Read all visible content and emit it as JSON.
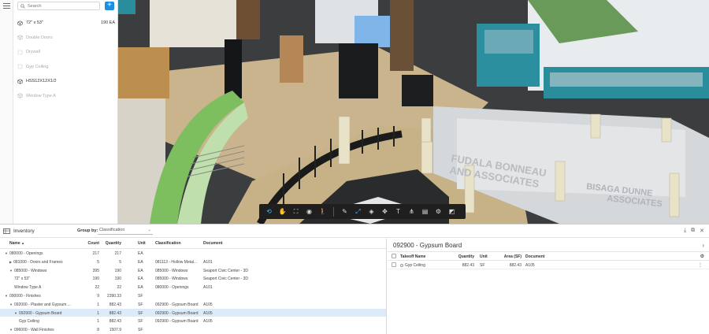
{
  "search": {
    "placeholder": "Search"
  },
  "takeoffs": [
    {
      "name": "72\" x 53\"",
      "quantity": "190 EA",
      "icon": "cube-icon",
      "active": true
    },
    {
      "name": "Double Doors",
      "quantity": "",
      "icon": "cube-icon",
      "active": false
    },
    {
      "name": "Drywall",
      "quantity": "",
      "icon": "area-icon",
      "active": false
    },
    {
      "name": "Gyp Ceiling",
      "quantity": "",
      "icon": "area-icon",
      "active": false
    },
    {
      "name": "HSS12X12X1/2",
      "quantity": "",
      "icon": "cube-icon",
      "active": true
    },
    {
      "name": "Window Type A",
      "quantity": "",
      "icon": "cube-icon",
      "active": false
    }
  ],
  "viewport": {
    "sign_1_line1": "FUDALA BONNEAU",
    "sign_1_line2": "AND ASSOCIATES",
    "sign_2_line1": "BISAGA DUNNE",
    "sign_2_line2": "ASSOCIATES"
  },
  "toolbar": {
    "tools": [
      "orbit-icon",
      "hand-icon",
      "fit-icon",
      "camera-icon",
      "walk-icon",
      "pencil-icon",
      "measure-icon",
      "layers-icon",
      "cube-sections-icon",
      "text-icon",
      "tree-icon",
      "properties-icon",
      "settings-icon",
      "fullscreen-icon"
    ]
  },
  "inventory": {
    "title": "Inventory",
    "group_by_label": "Group by:",
    "group_by_value": "Classification",
    "columns": {
      "name": "Name",
      "count": "Count",
      "quantity": "Quantity",
      "unit": "Unit",
      "classification": "Classification",
      "document": "Document"
    },
    "rows": [
      {
        "indent": 0,
        "tri": "▼",
        "name": "080000 - Openings",
        "count": "217",
        "qty": "217",
        "unit": "EA",
        "cls": "",
        "doc": ""
      },
      {
        "indent": 1,
        "tri": "▶",
        "name": "081000 - Doors and Frames",
        "count": "5",
        "qty": "5",
        "unit": "EA",
        "cls": "081113 - Hollow Metal...",
        "doc": "A101"
      },
      {
        "indent": 1,
        "tri": "▼",
        "name": "085000 - Windows",
        "count": "395",
        "qty": "190",
        "unit": "EA",
        "cls": "085000 - Windows",
        "doc": "Seaport Civic Center - 3D"
      },
      {
        "indent": 2,
        "tri": "",
        "name": "72\" x 53\"",
        "count": "190",
        "qty": "190",
        "unit": "EA",
        "cls": "085000 - Windows",
        "doc": "Seaport Civic Center - 3D"
      },
      {
        "indent": 2,
        "tri": "",
        "name": "Window Type A",
        "count": "22",
        "qty": "22",
        "unit": "EA",
        "cls": "080000 - Openings",
        "doc": "A101"
      },
      {
        "indent": 0,
        "tri": "▼",
        "name": "090000 - Finishes",
        "count": "9",
        "qty": "2390.33",
        "unit": "SF",
        "cls": "",
        "doc": ""
      },
      {
        "indent": 1,
        "tri": "▼",
        "name": "092000 - Plaster and Gypsum ...",
        "count": "1",
        "qty": "882.43",
        "unit": "SF",
        "cls": "092900 - Gypsum Board",
        "doc": "A105"
      },
      {
        "indent": 2,
        "tri": "▼",
        "name": "092900 - Gypsum Board",
        "count": "1",
        "qty": "882.43",
        "unit": "SF",
        "cls": "092900 - Gypsum Board",
        "doc": "A105",
        "selected": true
      },
      {
        "indent": 3,
        "tri": "",
        "name": "Gyp Ceiling",
        "count": "1",
        "qty": "882.43",
        "unit": "SF",
        "cls": "092900 - Gypsum Board",
        "doc": "A105"
      },
      {
        "indent": 1,
        "tri": "▼",
        "name": "096000 - Wall Finishes",
        "count": "8",
        "qty": "1507.9",
        "unit": "SF",
        "cls": "",
        "doc": ""
      }
    ]
  },
  "detail": {
    "title": "092900 - Gypsum Board",
    "columns": {
      "name": "Takeoff Name",
      "quantity": "Quantity",
      "unit": "Unit",
      "area": "Area (SF)",
      "document": "Document"
    },
    "rows": [
      {
        "name": "Gyp Ceiling",
        "quantity": "882.43",
        "unit": "SF",
        "area": "882.43",
        "document": "A105"
      }
    ]
  }
}
